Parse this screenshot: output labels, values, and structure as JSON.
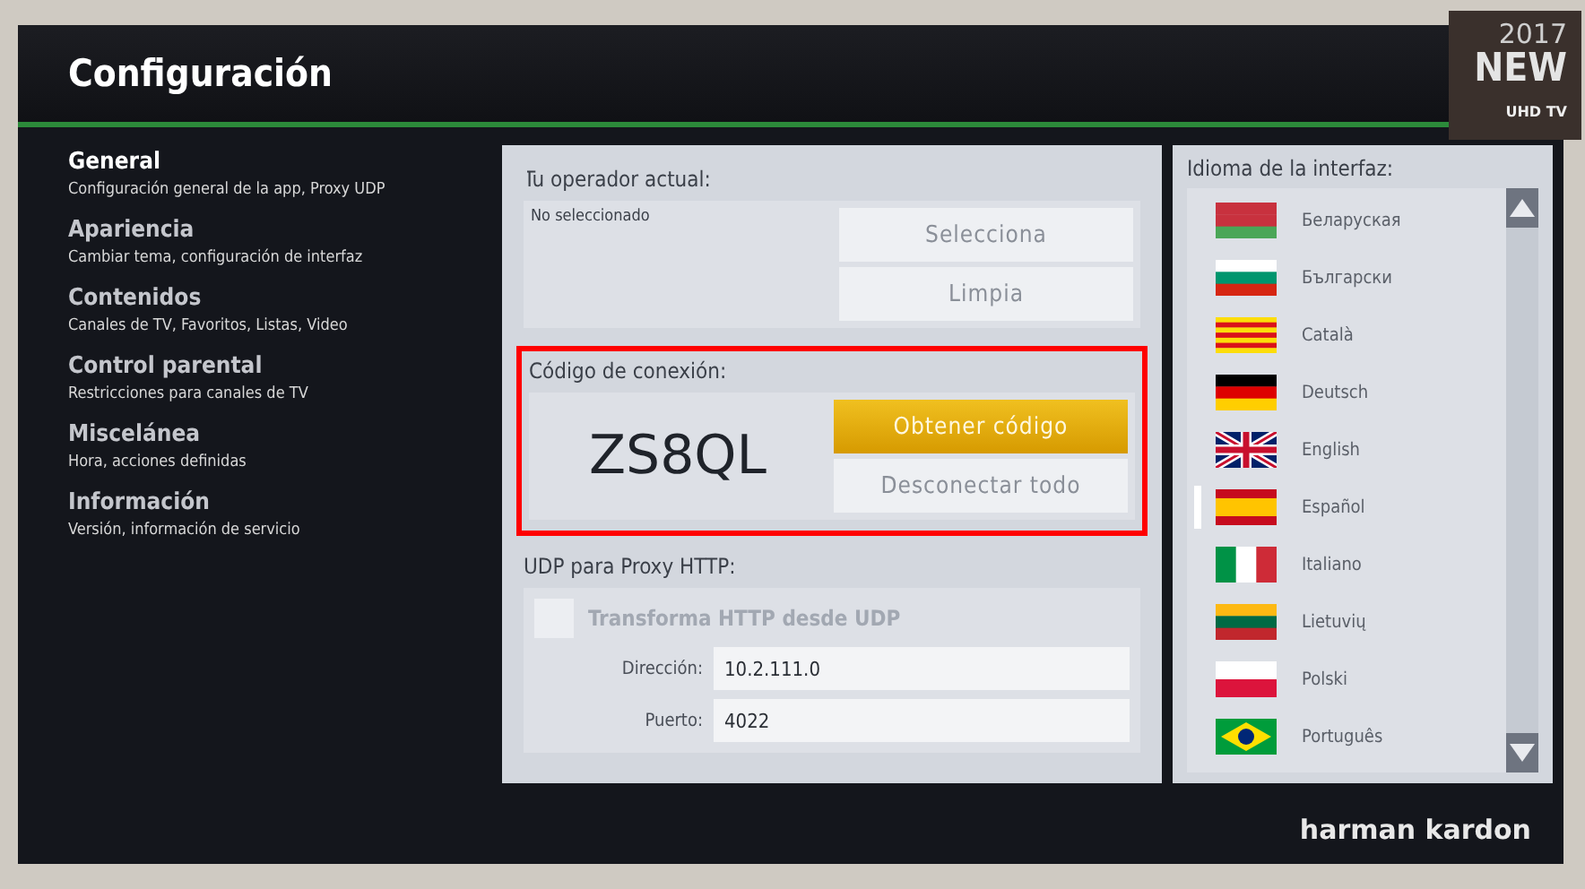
{
  "header": {
    "title": "Configuración"
  },
  "sticker": {
    "year": "2017",
    "badge": "NEW",
    "label": "UHD TV"
  },
  "sidebar": {
    "items": [
      {
        "title": "General",
        "subtitle": "Configuración general de la app, Proxy UDP",
        "selected": true
      },
      {
        "title": "Apariencia",
        "subtitle": "Cambiar tema, configuración de interfaz",
        "selected": false
      },
      {
        "title": "Contenidos",
        "subtitle": "Canales de TV, Favoritos, Listas, Video",
        "selected": false
      },
      {
        "title": "Control parental",
        "subtitle": "Restricciones para canales de TV",
        "selected": false
      },
      {
        "title": "Miscelánea",
        "subtitle": "Hora, acciones definidas",
        "selected": false
      },
      {
        "title": "Información",
        "subtitle": "Versión, información de servicio",
        "selected": false
      }
    ]
  },
  "operator": {
    "label": "Tu operador actual:",
    "value": "No seleccionado",
    "buttons": [
      {
        "label": "Selecciona",
        "focused": false
      },
      {
        "label": "Limpia",
        "focused": false
      }
    ]
  },
  "connection": {
    "label": "Código de conexión:",
    "code": "ZS8QL",
    "highlighted": true,
    "buttons": [
      {
        "label": "Obtener código",
        "focused": true
      },
      {
        "label": "Desconectar todo",
        "focused": false
      }
    ]
  },
  "udp_proxy": {
    "label": "UDP para Proxy HTTP:",
    "checkbox": {
      "label": "Transforma HTTP desde UDP",
      "checked": false,
      "disabled": true
    },
    "fields": [
      {
        "label": "Dirección:",
        "value": "10.2.111.0"
      },
      {
        "label": "Puerto:",
        "value": "4022"
      }
    ]
  },
  "language": {
    "label": "Idioma de la interfaz:",
    "items": [
      {
        "name": "Беларуская",
        "selected": false
      },
      {
        "name": "Български",
        "selected": false
      },
      {
        "name": "Català",
        "selected": false
      },
      {
        "name": "Deutsch",
        "selected": false
      },
      {
        "name": "English",
        "selected": false
      },
      {
        "name": "Español",
        "selected": true
      },
      {
        "name": "Italiano",
        "selected": false
      },
      {
        "name": "Lietuvių",
        "selected": false
      },
      {
        "name": "Polski",
        "selected": false
      },
      {
        "name": "Português",
        "selected": false
      }
    ]
  },
  "brand": "harman kardon"
}
